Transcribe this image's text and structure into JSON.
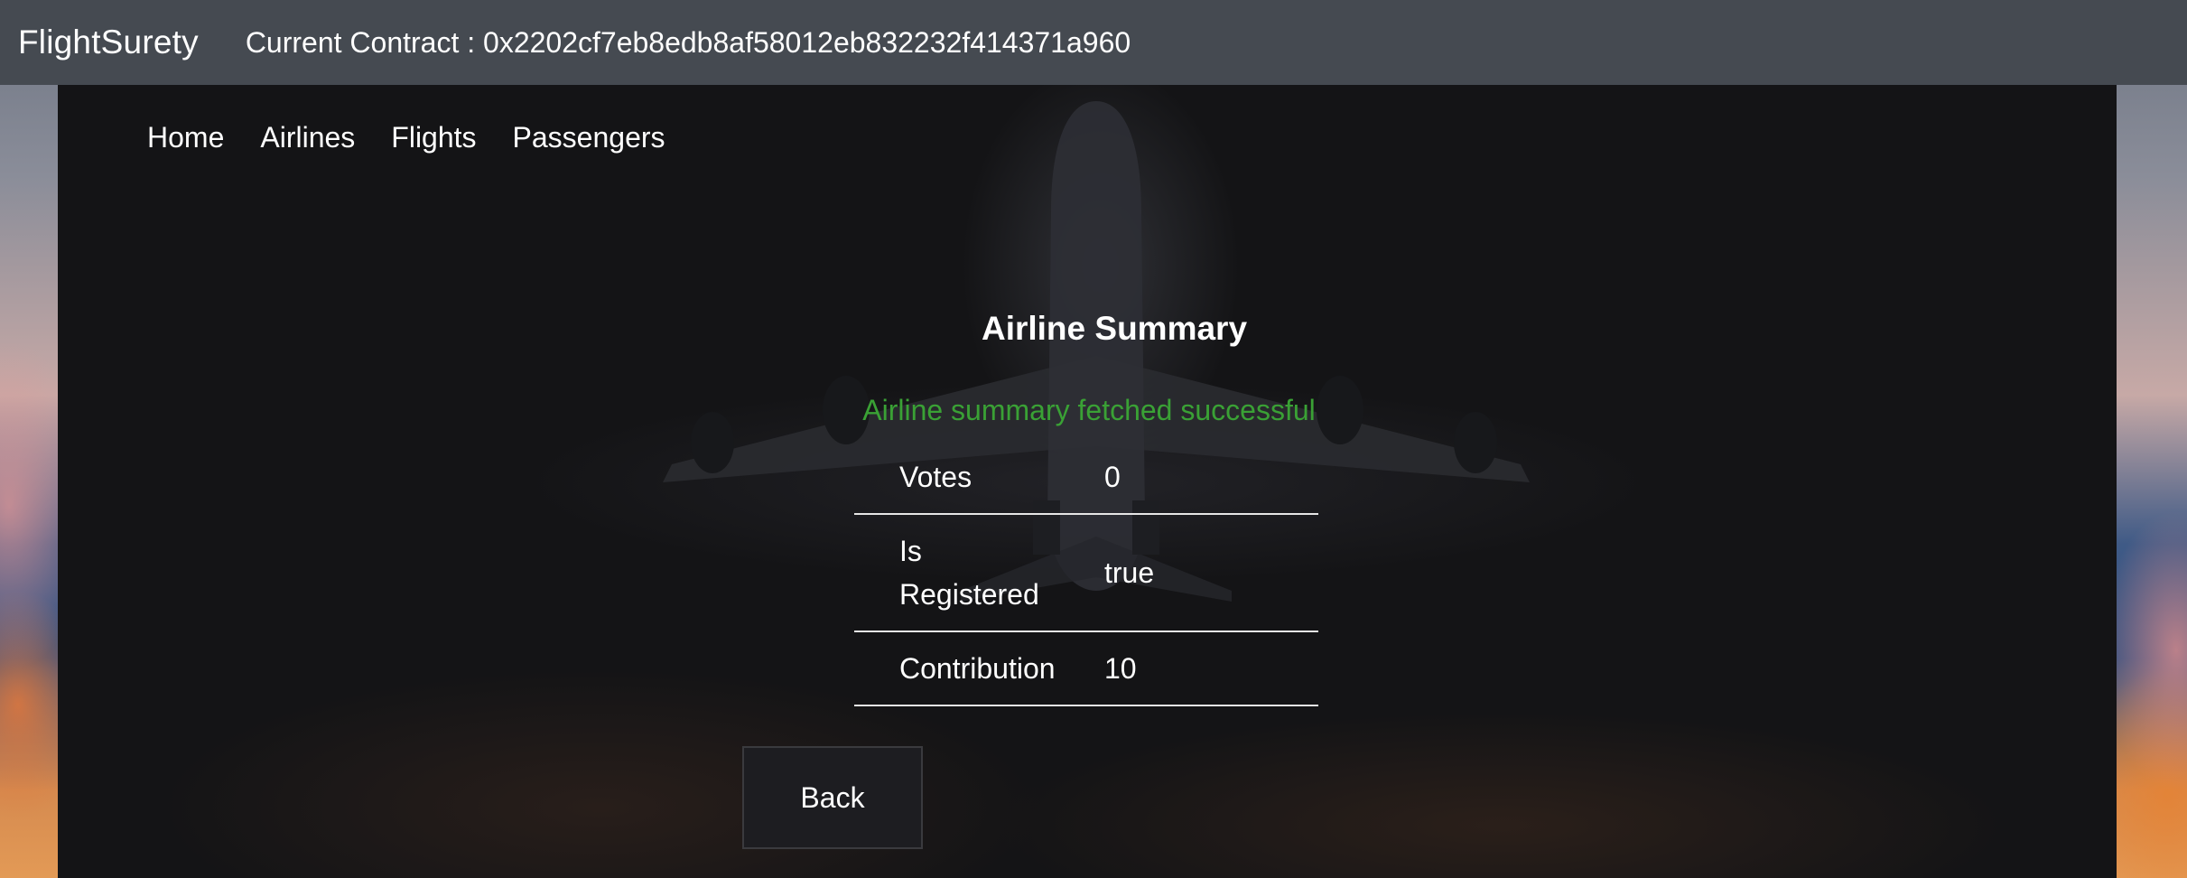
{
  "header": {
    "brand": "FlightSurety",
    "contract_text": "Current Contract : 0x2202cf7eb8edb8af58012eb832232f414371a960"
  },
  "nav": {
    "items": [
      {
        "label": "Home"
      },
      {
        "label": "Airlines"
      },
      {
        "label": "Flights"
      },
      {
        "label": "Passengers"
      }
    ]
  },
  "main": {
    "title": "Airline Summary",
    "status_message": "Airline summary fetched successful",
    "status_color": "#3aa135",
    "summary": [
      {
        "label": "Votes",
        "value": "0"
      },
      {
        "label": "Is Registered",
        "value": "true"
      },
      {
        "label": "Contribution",
        "value": "10"
      }
    ],
    "back_label": "Back"
  },
  "colors": {
    "topbar": "#454a51",
    "container": "#141416",
    "text": "#ffffff"
  }
}
